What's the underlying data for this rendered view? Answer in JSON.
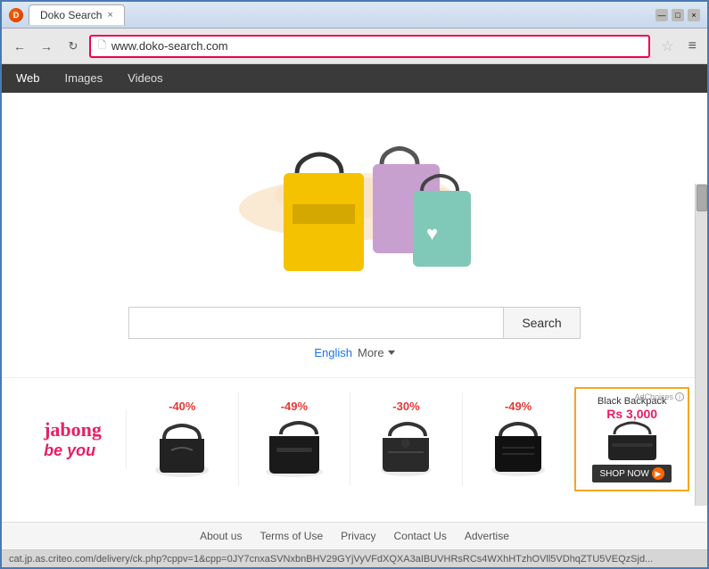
{
  "browser": {
    "title": "Doko Search",
    "tab_close": "×",
    "url": "www.doko-search.com",
    "controls": {
      "minimize": "—",
      "maximize": "□",
      "close": "×"
    },
    "nav_back": "←",
    "nav_forward": "→",
    "nav_refresh": "↻",
    "star": "☆",
    "menu": "≡"
  },
  "nav_tabs": [
    {
      "label": "Web",
      "active": true
    },
    {
      "label": "Images",
      "active": false
    },
    {
      "label": "Videos",
      "active": false
    }
  ],
  "search": {
    "placeholder": "",
    "button_label": "Search",
    "language": "English",
    "more_label": "More"
  },
  "ads": {
    "brand": {
      "name": "jabong",
      "tagline": "be you"
    },
    "items": [
      {
        "discount": "-40%",
        "alt": "Black bag 1"
      },
      {
        "discount": "-49%",
        "alt": "Black bag 2"
      },
      {
        "discount": "-30%",
        "alt": "Black bag 3"
      },
      {
        "discount": "-49%",
        "alt": "Black bag 4"
      }
    ],
    "special": {
      "ad_choices": "AdChoices",
      "product": "Black Backpack",
      "price": "Rs 3,000",
      "shop_now": "SHOP NOW"
    }
  },
  "footer": {
    "about": "About us",
    "terms": "Terms of Use",
    "privacy": "Privacy",
    "contact": "Contact Us",
    "advertise": "Advertise"
  },
  "status_bar": {
    "url": "cat.jp.as.criteo.com/delivery/ck.php?cppv=1&cpp=0JY7cnxaSVNxbnBHV29GYjVyVFdXQXA3aIBUVHRsRCs4WXhHTzhOVll5VDhqZTU5VEQzSjd..."
  }
}
